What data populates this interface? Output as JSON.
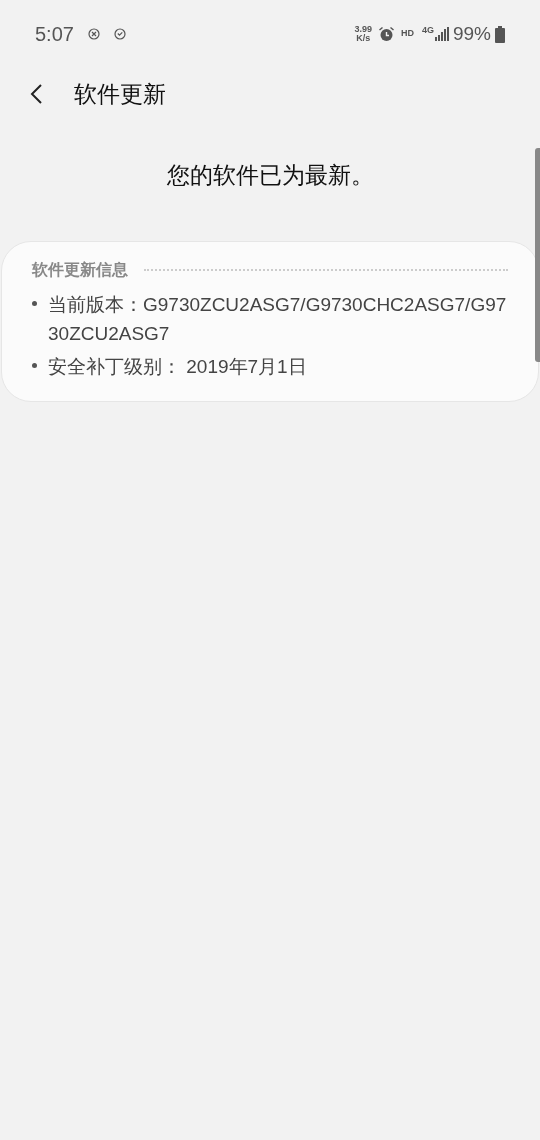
{
  "status_bar": {
    "time": "5:07",
    "speed": "3.99",
    "speed_unit": "K/s",
    "hd": "HD",
    "network": "4G",
    "battery": "99%"
  },
  "header": {
    "title": "软件更新"
  },
  "message": "您的软件已为最新。",
  "info_card": {
    "title": "软件更新信息",
    "items": [
      {
        "text": "当前版本：G9730ZCU2ASG7/G9730CHC2ASG7/G9730ZCU2ASG7"
      },
      {
        "text": "安全补丁级别： 2019年7月1日"
      }
    ]
  }
}
